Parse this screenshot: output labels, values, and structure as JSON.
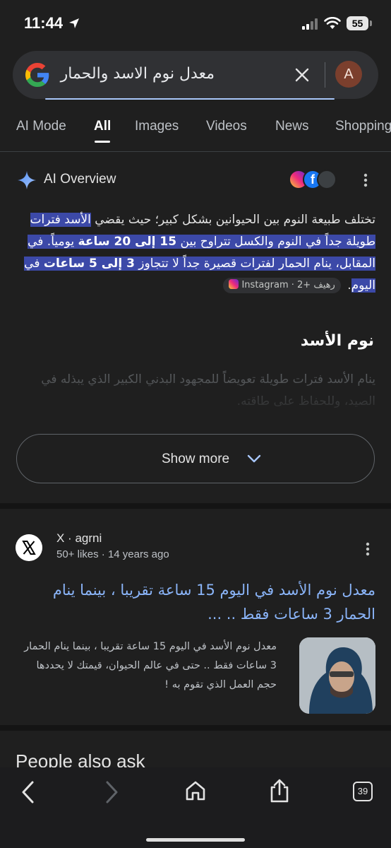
{
  "status_bar": {
    "time": "11:44",
    "battery": "55"
  },
  "search": {
    "query": "معدل نوم الاسد والحمار",
    "avatar_letter": "A"
  },
  "tabs": [
    {
      "label": "AI Mode"
    },
    {
      "label": "All"
    },
    {
      "label": "Images"
    },
    {
      "label": "Videos"
    },
    {
      "label": "News"
    },
    {
      "label": "Shopping"
    }
  ],
  "ai_overview": {
    "title": "AI Overview",
    "fb_letter": "f",
    "para_plain_1": "تختلف طبيعة النوم بين الحيوانين بشكل كبير؛ حيث يقضي ",
    "para_hl_1": "الأسد فترات طويلة جداً في النوم والكسل تتراوح بين ",
    "para_hl_bold_1": "15 إلى 20 ساعة",
    "para_hl_2": " يومياً. في المقابل، ينام الحمار لفترات قصيرة جداً لا تتجاوز ",
    "para_hl_bold_2": "3 إلى 5 ساعات",
    "para_hl_3": " في اليوم",
    "para_end": ". ",
    "chip_source": "Instagram",
    "chip_more": "· رهيف +2",
    "subheading": "نوم الأسد",
    "subtext": "ينام الأسد فترات طويلة تعويضاً للمجهود البدني الكبير الذي يبذله في الصيد، وللحفاظ على طاقته.",
    "show_more": "Show more"
  },
  "result": {
    "source": "X · agrni",
    "meta": "50+ likes · 14 years ago",
    "title": "معدل نوم الأسد في اليوم 15 ساعة تقريبا ، بينما ينام الحمار 3 ساعات فقط .. ...",
    "snippet": "معدل نوم الأسد في اليوم 15 ساعة تقريبا ، بينما ينام الحمار 3 ساعات فقط .. حتى في عالم الحيوان، قيمتك لا يحددها حجم العمل الذي تقوم به !"
  },
  "people_also_ask": "People also ask",
  "bottom_nav": {
    "tab_count": "39"
  },
  "colors": {
    "background": "#1f1f1f",
    "link": "#8ab4f8",
    "highlight": "#3c49a8"
  },
  "icons": [
    "location-arrow-icon",
    "cell-signal-icon",
    "wifi-icon",
    "google-g-icon",
    "clear-icon",
    "ai-sparkle-icon",
    "more-vert-icon",
    "chevron-down-icon",
    "x-logo-icon",
    "back-icon",
    "forward-icon",
    "home-icon",
    "share-icon"
  ]
}
